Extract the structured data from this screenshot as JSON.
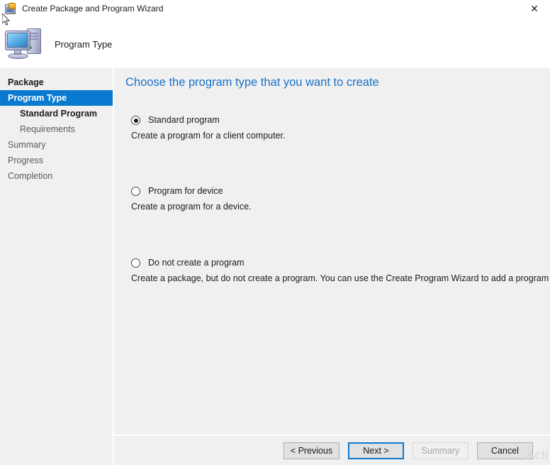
{
  "window": {
    "title": "Create Package and Program Wizard",
    "icon": "package-wizard-icon",
    "close_label": "✕"
  },
  "header": {
    "title": "Program Type",
    "icon": "computer-icon"
  },
  "sidebar": {
    "items": [
      {
        "label": "Package",
        "state": "completed",
        "indent": false
      },
      {
        "label": "Program Type",
        "state": "selected",
        "indent": false
      },
      {
        "label": "Standard Program",
        "state": "completed",
        "indent": true
      },
      {
        "label": "Requirements",
        "state": "upcoming",
        "indent": true
      },
      {
        "label": "Summary",
        "state": "upcoming",
        "indent": false
      },
      {
        "label": "Progress",
        "state": "upcoming",
        "indent": false
      },
      {
        "label": "Completion",
        "state": "upcoming",
        "indent": false
      }
    ]
  },
  "content": {
    "heading": "Choose the program type that you want to create",
    "options": [
      {
        "label": "Standard program",
        "description": "Create a program for a client computer.",
        "selected": true
      },
      {
        "label": "Program for device",
        "description": "Create a program for a device.",
        "selected": false
      },
      {
        "label": "Do not create a program",
        "description": "Create a package, but do not create a program. You can use the Create Program Wizard to add a program later.",
        "selected": false
      }
    ]
  },
  "buttons": {
    "previous": "< Previous",
    "next": "Next >",
    "summary": "Summary",
    "cancel": "Cancel"
  },
  "watermark": {
    "text": "Acti"
  },
  "colors": {
    "accent": "#0a7ad1",
    "heading": "#1b71c9",
    "surface": "#f0f0f0",
    "text": "#1b1b1b",
    "muted": "#5a5a5a",
    "disabled": "#a5a5a5"
  }
}
